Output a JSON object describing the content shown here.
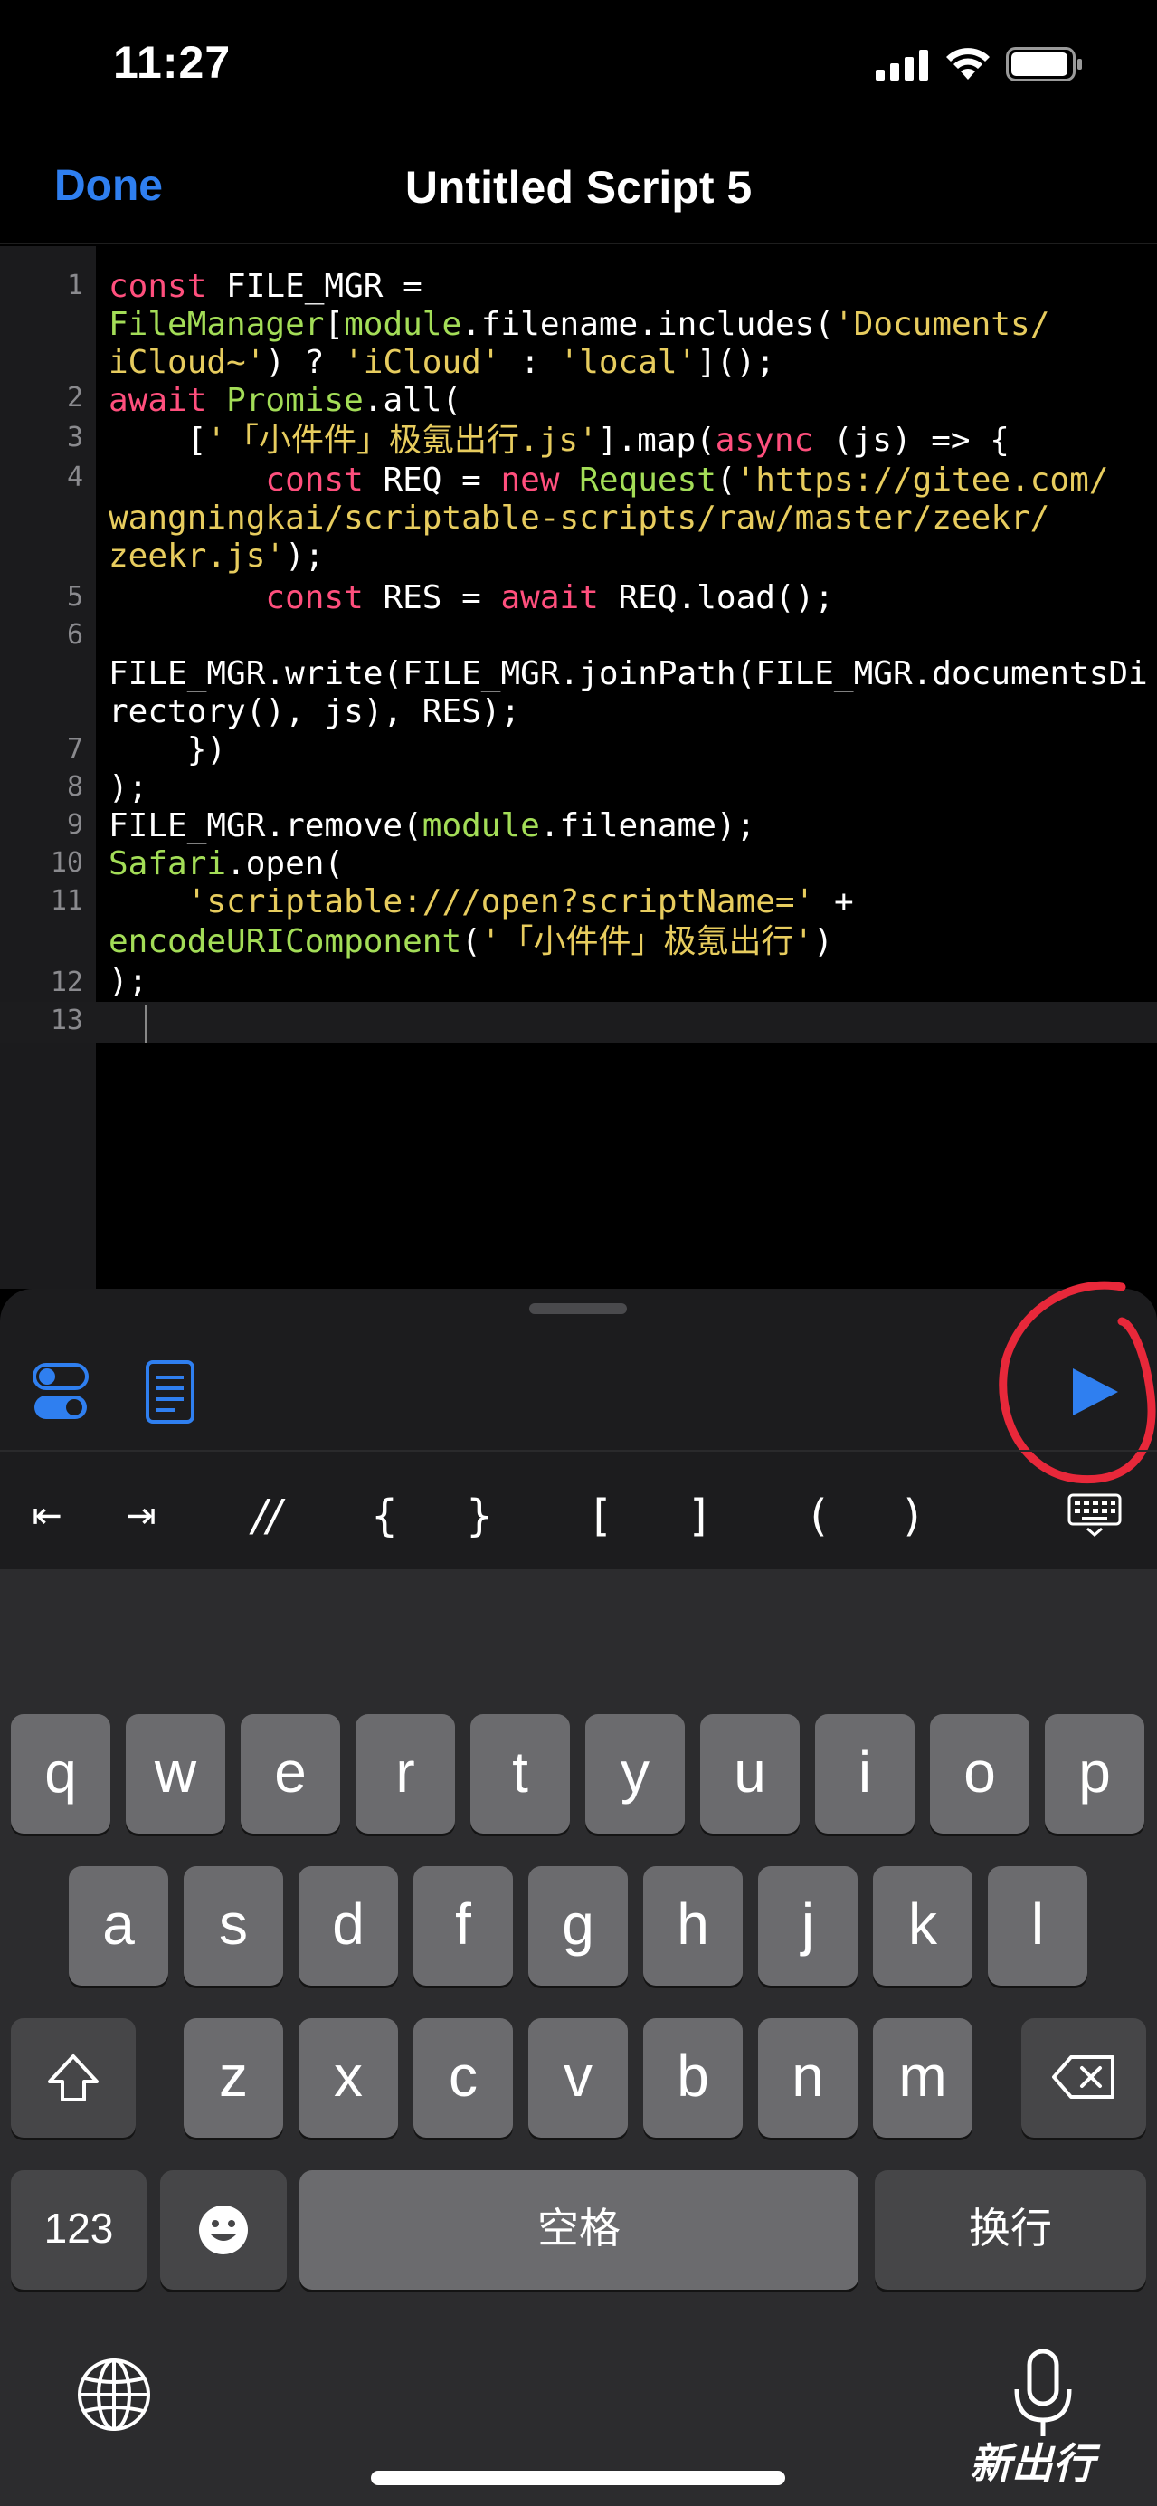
{
  "status_bar": {
    "time": "11:27"
  },
  "nav": {
    "done_label": "Done",
    "title": "Untitled Script 5"
  },
  "editor": {
    "line_numbers": [
      "1",
      "2",
      "3",
      "4",
      "5",
      "6",
      "7",
      "8",
      "9",
      "10",
      "11",
      "12",
      "13"
    ]
  },
  "accessory_bar": {
    "outdent": "⇤",
    "indent": "⇥",
    "comment": "//",
    "brace_open": "{",
    "brace_close": "}",
    "bracket_open": "[",
    "bracket_close": "]",
    "paren_open": "(",
    "paren_close": ")"
  },
  "keyboard": {
    "row1": [
      "q",
      "w",
      "e",
      "r",
      "t",
      "y",
      "u",
      "i",
      "o",
      "p"
    ],
    "row2": [
      "a",
      "s",
      "d",
      "f",
      "g",
      "h",
      "j",
      "k",
      "l"
    ],
    "row3": [
      "z",
      "x",
      "c",
      "v",
      "b",
      "n",
      "m"
    ],
    "numbers_label": "123",
    "space_label": "空格",
    "return_label": "换行"
  },
  "watermark": "新出行",
  "colors": {
    "accent": "#2f7ff0",
    "keyword": "#ff4f7d",
    "function": "#a3dd57",
    "string": "#e7cc5e",
    "annotation": "#e8283a"
  }
}
